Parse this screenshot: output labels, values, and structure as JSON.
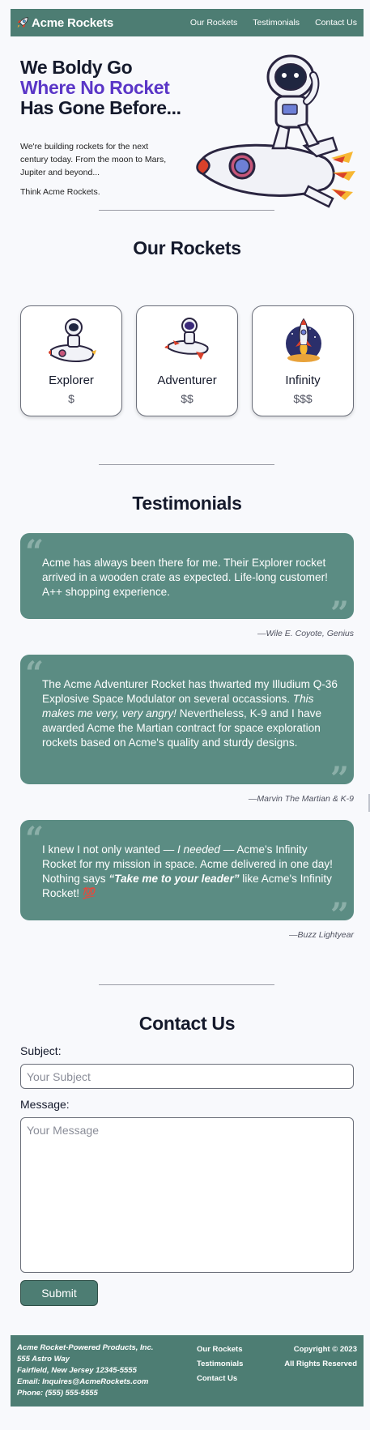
{
  "header": {
    "brand": "Acme Rockets",
    "brand_icon": "rocket-icon",
    "nav": [
      "Our Rockets",
      "Testimonials",
      "Contact Us"
    ]
  },
  "hero": {
    "title_line1": "We Boldy Go",
    "title_accent": "Where No Rocket",
    "title_line3": "Has Gone Before...",
    "description": "We're building rockets for the next century today. From the moon to Mars, Jupiter and beyond...",
    "tagline": "Think Acme Rockets.",
    "image": "astronaut-riding-rocket"
  },
  "rockets": {
    "title": "Our Rockets",
    "items": [
      {
        "name": "Explorer",
        "price": "$",
        "image": "astronaut-on-rocket"
      },
      {
        "name": "Adventurer",
        "price": "$$",
        "image": "astronaut-flying-rocket"
      },
      {
        "name": "Infinity",
        "price": "$$$",
        "image": "rocket-launch"
      }
    ]
  },
  "testimonials": {
    "title": "Testimonials",
    "items": [
      {
        "quote": "Acme has always been there for me. Their Explorer rocket arrived in a wooden crate as expected. Life-long customer! A++ shopping experience.",
        "author": "—Wile E. Coyote, Genius"
      },
      {
        "quote_a": "The Acme Adventurer Rocket has thwarted my Illudium Q-36 Explosive Space Modulator on several occassions. ",
        "quote_em": "This makes me very, very angry!",
        "quote_b": " Nevertheless, K-9 and I have awarded Acme the Martian contract for space exploration rockets based on Acme's quality and sturdy designs.",
        "author": "—Marvin The Martian & K-9"
      },
      {
        "quote_a": "I knew I not only wanted — ",
        "quote_em": "I needed",
        "quote_b": " — Acme's Infinity Rocket for my mission in space. Acme delivered in one day! Nothing says ",
        "quote_em2": "“Take me to your leader”",
        "quote_c": " like Acme's Infinity Rocket! 💯",
        "author": "—Buzz Lightyear"
      }
    ]
  },
  "contact": {
    "title": "Contact Us",
    "subject_label": "Subject:",
    "subject_placeholder": "Your Subject",
    "message_label": "Message:",
    "message_placeholder": "Your Message",
    "submit": "Submit"
  },
  "footer": {
    "company": "Acme Rocket-Powered Products, Inc.",
    "street": "555 Astro Way",
    "city": "Fairfield, New Jersey 12345-5555",
    "email": "Email: Inquires@AcmeRockets.com",
    "phone": "Phone: (555) 555-5555",
    "links": [
      "Our Rockets",
      "Testimonials",
      "Contact Us"
    ],
    "copyright": "Copyright © 2023",
    "rights": "All Rights Reserved"
  },
  "colors": {
    "primary": "#4d7d73",
    "quote_bg": "#5b8c83",
    "accent": "#5a36c7"
  }
}
